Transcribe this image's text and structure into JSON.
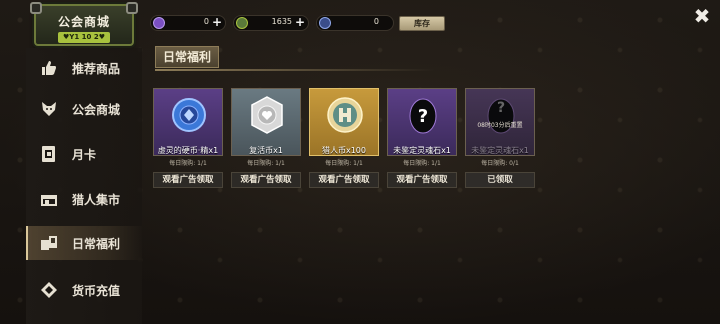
{
  "header": {
    "title": "公会商城",
    "level": "♥Y1 10 2♥"
  },
  "currencies": [
    {
      "icon": "purple-gem-icon",
      "value": "0",
      "plus": "+"
    },
    {
      "icon": "green-coin-icon",
      "value": "1635",
      "plus": "+"
    },
    {
      "icon": "blue-crystal-icon",
      "value": "0"
    }
  ],
  "stock_label": "库存",
  "close_label": "✖",
  "sidebar": {
    "items": [
      {
        "label": "推荐商品",
        "icon": "thumbs-up-icon"
      },
      {
        "label": "公会商城",
        "icon": "wolf-emblem-icon"
      },
      {
        "label": "月卡",
        "icon": "card-icon"
      },
      {
        "label": "猎人集市",
        "icon": "market-stall-icon"
      },
      {
        "label": "日常福利",
        "icon": "daily-cards-icon",
        "active": true
      },
      {
        "label": "货币充值",
        "icon": "diamond-currency-icon"
      }
    ]
  },
  "section": {
    "title": "日常福利"
  },
  "cards": [
    {
      "name": "虚灵的硬币·精x1",
      "limit": "每日限购: 1/1",
      "button": "观看广告领取",
      "style": "purple",
      "icon": "blue-coin-icon"
    },
    {
      "name": "复活币x1",
      "limit": "每日限购: 1/1",
      "button": "观看广告领取",
      "style": "grey",
      "icon": "revive-coin-icon"
    },
    {
      "name": "猎人币x100",
      "limit": "每日限购: 1/1",
      "button": "观看广告领取",
      "style": "gold",
      "icon": "hunter-coin-icon"
    },
    {
      "name": "未鉴定灵魂石x1",
      "limit": "每日限购: 1/1",
      "button": "观看广告领取",
      "style": "purple",
      "icon": "mystery-egg-icon"
    },
    {
      "name": "未鉴定灵魂石x1",
      "limit": "每日限购: 0/1",
      "button": "已领取",
      "style": "dim",
      "icon": "mystery-egg-icon",
      "reset_note": "08时03分后重置"
    }
  ],
  "colors": {
    "accent_green": "#a8c23e",
    "card_purple": "#5b3f86",
    "card_gold": "#c79a3c",
    "button_bg": "#2d2a26"
  }
}
